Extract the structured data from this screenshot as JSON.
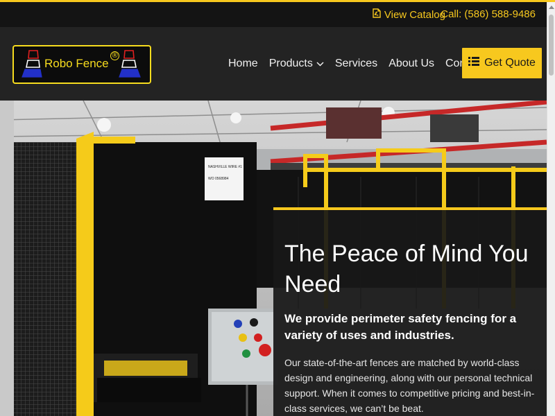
{
  "utility": {
    "catalog_label": "View Catalog",
    "phone_label": "Call: (586) 588-9486"
  },
  "brand": {
    "name": "Robo Fence",
    "trademark": "®"
  },
  "nav": {
    "items": [
      {
        "label": "Home"
      },
      {
        "label": "Products"
      },
      {
        "label": "Services"
      },
      {
        "label": "About Us"
      },
      {
        "label": "Contact"
      }
    ],
    "cta_label": "Get Quote"
  },
  "hero": {
    "heading": "The Peace of Mind You Need",
    "subheading": "We provide perimeter safety fencing for a variety of uses and industries.",
    "body": "Our state-of-the-art fences are matched by world-class design and engineering, along with our personal technical support. When it comes to competitive pricing and best-in-class services, we can’t be beat.",
    "photo_labels": [
      "NASHVILLE WIRE #1",
      "WO 0568984"
    ]
  },
  "colors": {
    "accent": "#f7c81e",
    "header_bg": "#232323",
    "utility_bg": "#141414"
  }
}
